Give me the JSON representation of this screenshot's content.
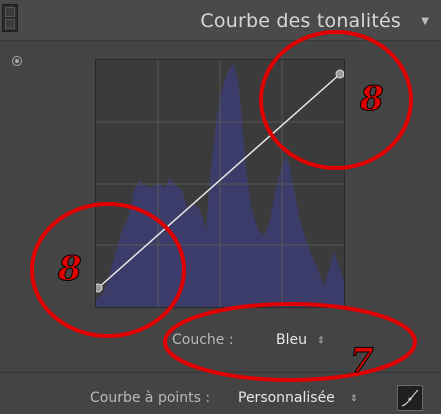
{
  "panel": {
    "title": "Courbe des tonalités",
    "title_arrow": "▼"
  },
  "channel": {
    "label": "Couche :",
    "value": "Bleu",
    "arrow": "⇕"
  },
  "point_curve": {
    "label": "Courbe à points :",
    "value": "Personnalisée",
    "arrow": "⇕"
  },
  "annotations": [
    {
      "label": "8"
    },
    {
      "label": "8"
    },
    {
      "label": "7"
    }
  ],
  "colors": {
    "histogram": "#3c3c6a",
    "curve": "#e8e8e8",
    "annotation": "#e00000"
  }
}
